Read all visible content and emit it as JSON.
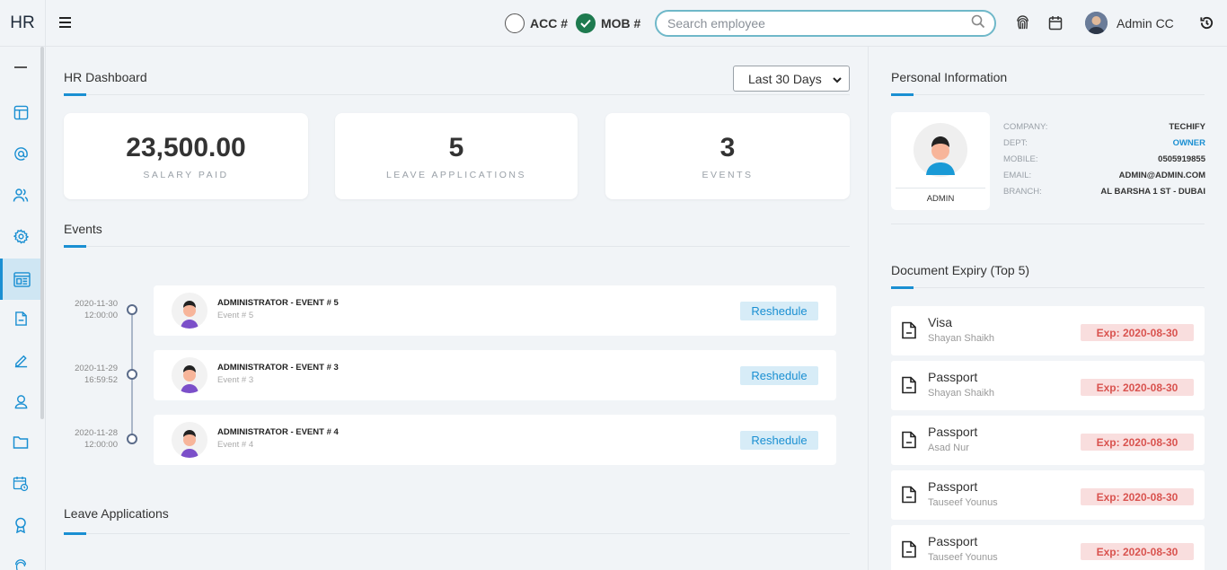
{
  "brand": "HR",
  "topbar": {
    "acc_label": "ACC #",
    "mob_label": "MOB #",
    "search_placeholder": "Search employee",
    "user_name": "Admin CC"
  },
  "dashboard": {
    "title": "HR Dashboard",
    "range_selected": "Last 30 Days",
    "stats": [
      {
        "value": "23,500.00",
        "label": "SALARY PAID"
      },
      {
        "value": "5",
        "label": "LEAVE APPLICATIONS"
      },
      {
        "value": "3",
        "label": "EVENTS"
      }
    ]
  },
  "events": {
    "title": "Events",
    "button_label": "Reshedule",
    "items": [
      {
        "date": "2020-11-30",
        "time": "12:00:00",
        "title": "ADMINISTRATOR - EVENT # 5",
        "subtitle": "Event # 5"
      },
      {
        "date": "2020-11-29",
        "time": "16:59:52",
        "title": "ADMINISTRATOR - EVENT # 3",
        "subtitle": "Event # 3"
      },
      {
        "date": "2020-11-28",
        "time": "12:00:00",
        "title": "ADMINISTRATOR - EVENT # 4",
        "subtitle": "Event # 4"
      }
    ]
  },
  "leave": {
    "title": "Leave Applications"
  },
  "personal": {
    "title": "Personal Information",
    "avatar_label": "ADMIN",
    "rows": [
      {
        "label": "COMPANY:",
        "value": "TECHIFY"
      },
      {
        "label": "DEPT:",
        "value": "OWNER"
      },
      {
        "label": "MOBILE:",
        "value": "0505919855"
      },
      {
        "label": "EMAIL:",
        "value": "ADMIN@ADMIN.COM"
      },
      {
        "label": "BRANCH:",
        "value": "AL BARSHA 1 ST - DUBAI"
      }
    ]
  },
  "documents": {
    "title": "Document Expiry (Top 5)",
    "items": [
      {
        "name": "Visa",
        "person": "Shayan Shaikh",
        "expiry": "Exp: 2020-08-30"
      },
      {
        "name": "Passport",
        "person": "Shayan Shaikh",
        "expiry": "Exp: 2020-08-30"
      },
      {
        "name": "Passport",
        "person": "Asad Nur",
        "expiry": "Exp: 2020-08-30"
      },
      {
        "name": "Passport",
        "person": "Tauseef Younus",
        "expiry": "Exp: 2020-08-30"
      },
      {
        "name": "Passport",
        "person": "Tauseef Younus",
        "expiry": "Exp: 2020-08-30"
      }
    ]
  },
  "colors": {
    "accent": "#1a8fd2",
    "expiry_bg": "#f9dede",
    "expiry_text": "#d9534f",
    "toggle_on": "#1e7a4f"
  }
}
